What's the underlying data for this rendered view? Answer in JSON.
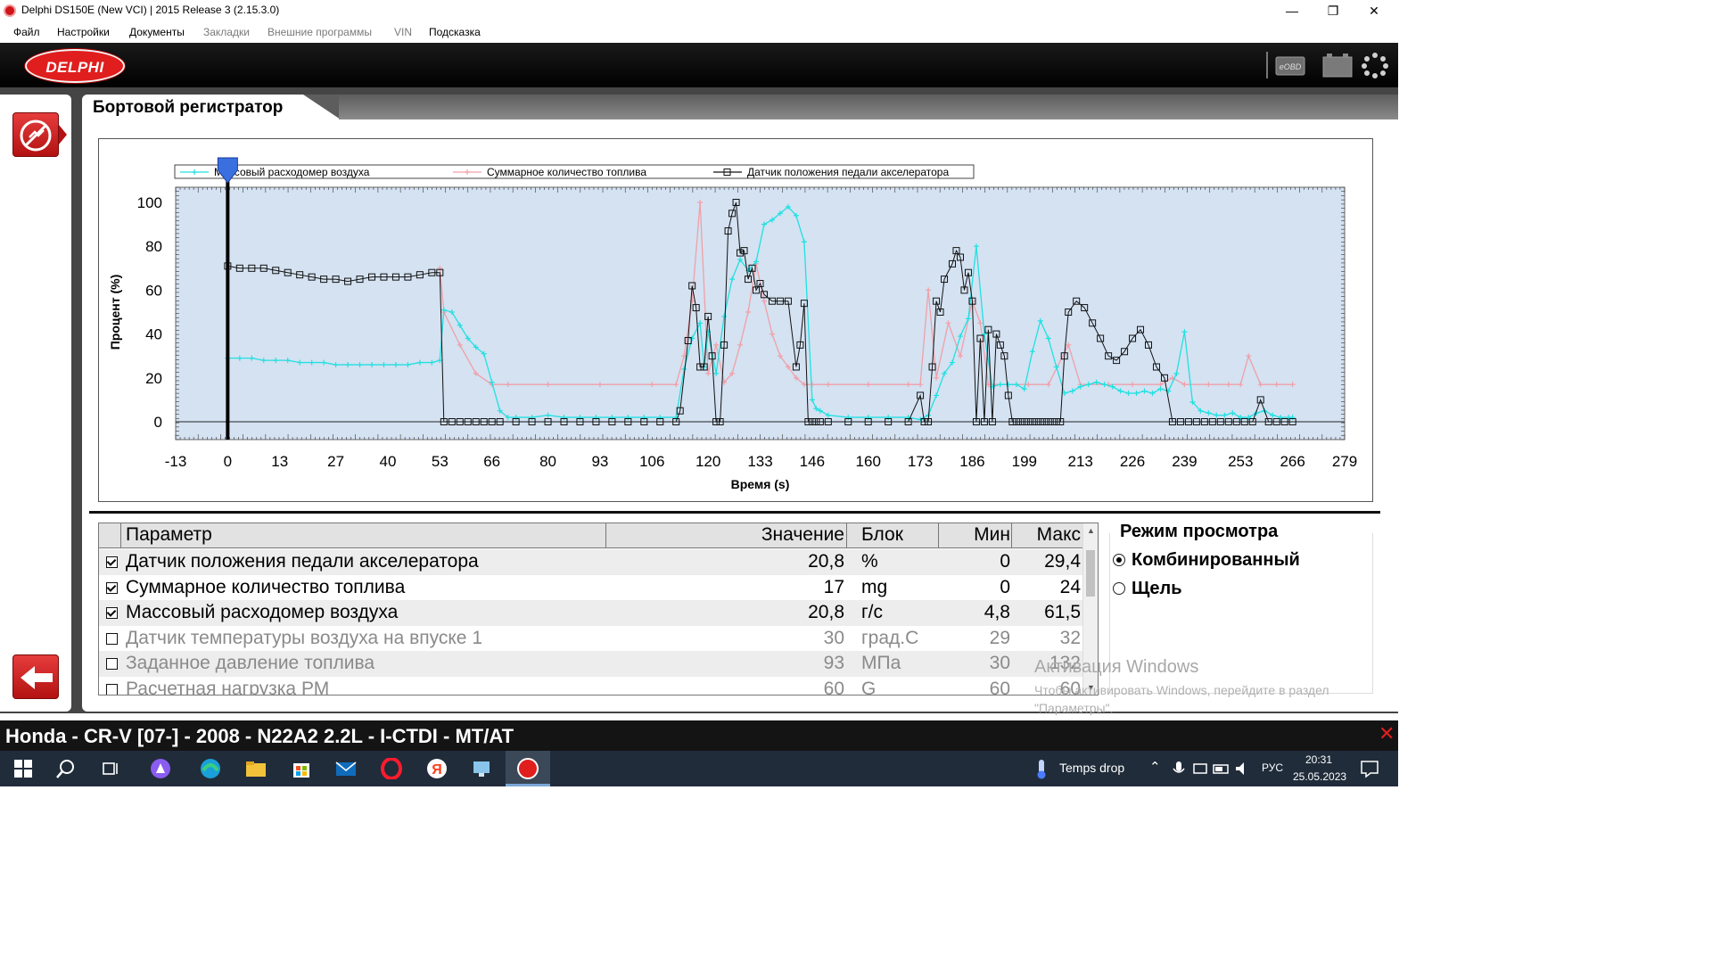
{
  "window": {
    "title": "Delphi DS150E (New VCI) | 2015 Release 3 (2.15.3.0)",
    "minimize": "—",
    "restore": "❐",
    "close": "✕"
  },
  "menu": [
    {
      "label": "Файл",
      "dim": false
    },
    {
      "label": "Настройки",
      "dim": false
    },
    {
      "label": "Документы",
      "dim": false
    },
    {
      "label": "Закладки",
      "dim": true
    },
    {
      "label": "Внешние программы",
      "dim": true
    },
    {
      "label": "VIN",
      "dim": true
    },
    {
      "label": "Подсказка",
      "dim": false
    }
  ],
  "header": {
    "logo_text": "DELPHI",
    "eobd_label": "eOBD",
    "icons": [
      "eobd-icon",
      "battery-icon",
      "loading-icon"
    ]
  },
  "page_title": "Бортовой регистратор",
  "chart_data": {
    "type": "line",
    "title": "",
    "xlabel": "Время (s)",
    "ylabel": "Процент (%)",
    "xlim": [
      -13,
      279
    ],
    "ylim": [
      0,
      100
    ],
    "xticks": [
      -13,
      0,
      13,
      27,
      40,
      53,
      66,
      80,
      93,
      106,
      120,
      133,
      146,
      160,
      173,
      186,
      199,
      213,
      226,
      239,
      253,
      266,
      279
    ],
    "yticks": [
      0,
      20,
      40,
      60,
      80,
      100
    ],
    "cursor_x": 0,
    "grid": false,
    "legend": "top",
    "series": [
      {
        "name": "Массовый расходомер воздуха",
        "color": "#22e0e0",
        "marker": "plus",
        "x": [
          0,
          3,
          6,
          9,
          12,
          15,
          18,
          21,
          24,
          27,
          30,
          33,
          36,
          39,
          42,
          45,
          48,
          51,
          53,
          54,
          56,
          58,
          60,
          62,
          64,
          66,
          68,
          70,
          72,
          76,
          80,
          84,
          88,
          92,
          96,
          100,
          104,
          108,
          112,
          114,
          116,
          118,
          119,
          120,
          122,
          124,
          126,
          128,
          130,
          132,
          134,
          136,
          138,
          140,
          142,
          144,
          146,
          147,
          148,
          150,
          155,
          160,
          165,
          170,
          173,
          175,
          177,
          179,
          181,
          183,
          185,
          187,
          189,
          191,
          193,
          195,
          197,
          199,
          201,
          203,
          205,
          207,
          209,
          211,
          213,
          215,
          217,
          219,
          221,
          223,
          225,
          227,
          229,
          231,
          233,
          235,
          237,
          239,
          241,
          243,
          245,
          247,
          249,
          251,
          253,
          255,
          257,
          259,
          261,
          263,
          265,
          266
        ],
        "y": [
          29,
          29,
          29,
          28,
          28,
          28,
          27,
          27,
          27,
          26,
          26,
          26,
          26,
          26,
          26,
          26,
          27,
          27,
          28,
          51,
          50,
          44,
          38,
          34,
          31,
          18,
          5,
          2,
          2,
          2,
          3,
          2,
          2,
          2,
          2,
          2,
          2,
          2,
          2,
          24,
          38,
          45,
          25,
          41,
          22,
          48,
          65,
          74,
          69,
          73,
          90,
          92,
          95,
          98,
          94,
          82,
          10,
          6,
          5,
          3,
          2,
          2,
          2,
          2,
          1,
          3,
          12,
          22,
          27,
          39,
          47,
          80,
          40,
          16,
          17,
          17,
          17,
          15,
          32,
          46,
          38,
          25,
          13,
          14,
          16,
          17,
          18,
          17,
          16,
          14,
          13,
          13,
          14,
          13,
          15,
          14,
          22,
          41,
          9,
          5,
          4,
          3,
          3,
          4,
          2,
          2,
          4,
          5,
          3,
          2,
          2,
          2
        ]
      },
      {
        "name": "Суммарное количество топлива",
        "color": "#f0a0a8",
        "marker": "plus",
        "x": [
          53,
          54,
          58,
          62,
          66,
          70,
          80,
          93,
          106,
          112,
          114,
          116,
          118,
          120,
          122,
          124,
          126,
          128,
          130,
          132,
          134,
          136,
          138,
          140,
          142,
          144,
          146,
          150,
          160,
          170,
          173,
          175,
          177,
          180,
          183,
          186,
          188,
          190,
          195,
          200,
          205,
          210,
          213,
          220,
          226,
          233,
          236,
          239,
          245,
          250,
          253,
          255,
          258,
          262,
          266
        ],
        "y": [
          70,
          50,
          35,
          22,
          17,
          17,
          17,
          17,
          17,
          17,
          30,
          55,
          100,
          22,
          35,
          18,
          22,
          35,
          50,
          72,
          55,
          40,
          30,
          25,
          20,
          17,
          17,
          17,
          17,
          17,
          17,
          60,
          20,
          45,
          30,
          55,
          45,
          17,
          17,
          17,
          17,
          35,
          17,
          17,
          17,
          17,
          20,
          17,
          17,
          17,
          17,
          30,
          17,
          17,
          17
        ]
      },
      {
        "name": "Датчик положения педали акселератора",
        "color": "#111111",
        "marker": "square",
        "x": [
          0,
          3,
          6,
          9,
          12,
          15,
          18,
          21,
          24,
          27,
          30,
          33,
          36,
          39,
          42,
          45,
          48,
          51,
          53,
          54,
          56,
          58,
          60,
          62,
          64,
          66,
          68,
          72,
          76,
          80,
          84,
          88,
          92,
          96,
          100,
          104,
          108,
          112,
          113,
          115,
          116,
          117,
          118,
          119,
          120,
          121,
          122,
          123,
          124,
          125,
          126,
          127,
          128,
          129,
          130,
          131,
          132,
          133,
          134,
          136,
          138,
          140,
          142,
          143,
          144,
          145,
          146,
          147,
          148,
          150,
          155,
          160,
          165,
          170,
          173,
          174,
          175,
          176,
          177,
          178,
          179,
          181,
          182,
          183,
          184,
          185,
          186,
          187,
          188,
          189,
          190,
          191,
          192,
          193,
          194,
          195,
          196,
          197,
          198,
          199,
          200,
          201,
          202,
          203,
          204,
          205,
          206,
          207,
          208,
          209,
          210,
          212,
          214,
          216,
          218,
          220,
          222,
          224,
          226,
          228,
          230,
          232,
          234,
          236,
          238,
          240,
          242,
          244,
          246,
          248,
          250,
          252,
          254,
          256,
          258,
          260,
          262,
          264,
          266
        ],
        "y": [
          71,
          70,
          70,
          70,
          69,
          68,
          67,
          66,
          65,
          65,
          64,
          65,
          66,
          66,
          66,
          66,
          67,
          68,
          68,
          0,
          0,
          0,
          0,
          0,
          0,
          0,
          0,
          0,
          0,
          0,
          0,
          0,
          0,
          0,
          0,
          0,
          0,
          0,
          5,
          37,
          62,
          52,
          25,
          25,
          48,
          30,
          0,
          0,
          35,
          87,
          95,
          100,
          77,
          78,
          65,
          70,
          60,
          63,
          58,
          55,
          55,
          55,
          25,
          35,
          54,
          0,
          0,
          0,
          0,
          0,
          0,
          0,
          0,
          0,
          12,
          0,
          0,
          25,
          55,
          50,
          65,
          72,
          78,
          75,
          60,
          68,
          55,
          0,
          38,
          0,
          42,
          0,
          40,
          35,
          30,
          12,
          0,
          0,
          0,
          0,
          0,
          0,
          0,
          0,
          0,
          0,
          0,
          0,
          0,
          30,
          50,
          55,
          52,
          45,
          38,
          30,
          28,
          32,
          38,
          42,
          35,
          25,
          20,
          0,
          0,
          0,
          0,
          0,
          0,
          0,
          0,
          0,
          0,
          0,
          10,
          0,
          0,
          0,
          0
        ]
      }
    ]
  },
  "table": {
    "headers": {
      "param": "Параметр",
      "value": "Значение",
      "unit": "Блок",
      "min": "Мин",
      "max": "Макс"
    },
    "rows": [
      {
        "checked": true,
        "name": "Датчик положения педали акселератора",
        "value": "20,8",
        "unit": "%",
        "min": "0",
        "max": "29,4"
      },
      {
        "checked": true,
        "name": "Суммарное количество топлива",
        "value": "17",
        "unit": "mg",
        "min": "0",
        "max": "24"
      },
      {
        "checked": true,
        "name": "Массовый расходомер воздуха",
        "value": "20,8",
        "unit": "г/с",
        "min": "4,8",
        "max": "61,5"
      },
      {
        "checked": false,
        "name": "Датчик температуры воздуха на впуске 1",
        "value": "30",
        "unit": "град.C",
        "min": "29",
        "max": "32"
      },
      {
        "checked": false,
        "name": "Заданное давление топлива",
        "value": "93",
        "unit": "МПа",
        "min": "30",
        "max": "132"
      },
      {
        "checked": false,
        "name": "Расчетная нагрузка РМ",
        "value": "60",
        "unit": "G",
        "min": "60",
        "max": "60"
      }
    ]
  },
  "view_mode": {
    "title": "Режим просмотра",
    "options": [
      "Комбинированный",
      "Щель"
    ],
    "selected": 0
  },
  "watermark": {
    "title": "Активация Windows",
    "text": "Чтобы активировать Windows, перейдите в раздел \"Параметры\"."
  },
  "vehicle": "Honda - CR-V [07-] - 2008 - N22A2 2.2L - I-CTDI - MT/AT",
  "taskbar": {
    "weather": "Temps drop",
    "lang": "РУС",
    "time": "20:31",
    "date": "25.05.2023"
  }
}
